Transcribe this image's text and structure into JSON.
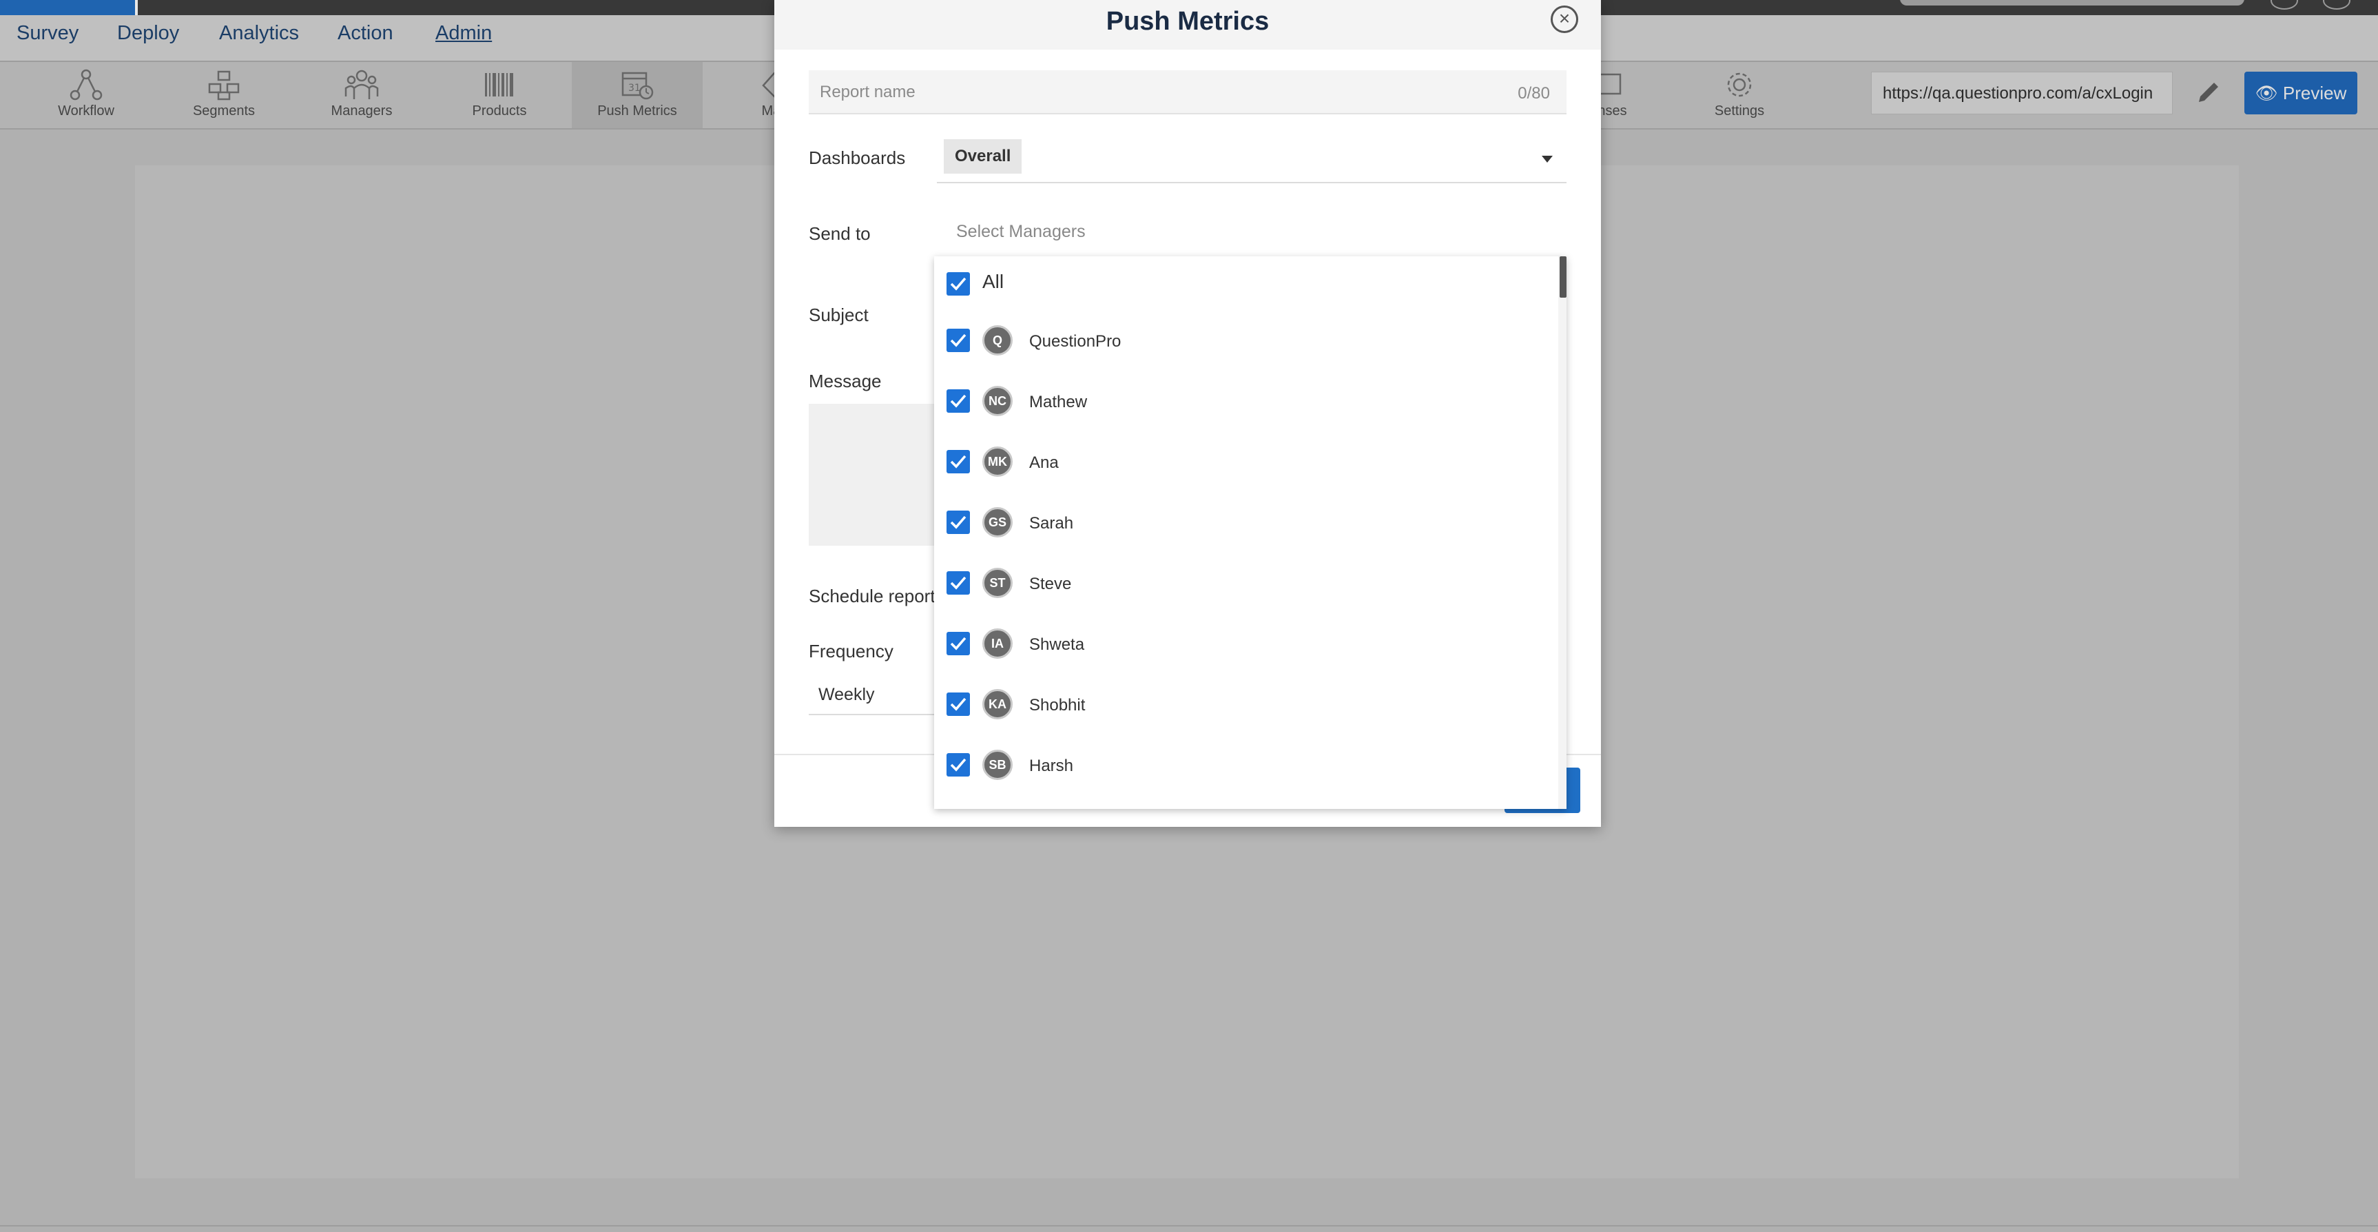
{
  "nav": {
    "items": [
      "Survey",
      "Deploy",
      "Analytics",
      "Action",
      "Admin"
    ],
    "active": "Admin"
  },
  "toolbar": {
    "tools": [
      {
        "label": "Workflow",
        "icon": "workflow-icon"
      },
      {
        "label": "Segments",
        "icon": "segments-icon"
      },
      {
        "label": "Managers",
        "icon": "managers-icon"
      },
      {
        "label": "Products",
        "icon": "barcode-icon"
      },
      {
        "label": "Push Metrics",
        "icon": "calendar-clock-icon"
      },
      {
        "label": "Map",
        "icon": "map-tag-icon"
      },
      {
        "label": "onses",
        "icon": "responses-icon"
      },
      {
        "label": "Settings",
        "icon": "gear-icon"
      }
    ],
    "active_tool": "Push Metrics",
    "url": "https://qa.questionpro.com/a/cxLogin",
    "preview_label": "Preview"
  },
  "modal": {
    "title": "Push Metrics",
    "report_name_placeholder": "Report name",
    "report_name_counter": "0/80",
    "dashboards_label": "Dashboards",
    "dashboards_value": "Overall",
    "send_to_label": "Send to",
    "send_to_placeholder": "Select Managers",
    "subject_label": "Subject",
    "message_label": "Message",
    "schedule_label": "Schedule report",
    "frequency_label": "Frequency",
    "frequency_value": "Weekly"
  },
  "dropdown": {
    "all_label": "All",
    "all_checked": true,
    "managers": [
      {
        "initials": "Q",
        "name": "QuestionPro",
        "checked": true
      },
      {
        "initials": "NC",
        "name": "Mathew",
        "checked": true
      },
      {
        "initials": "MK",
        "name": "Ana",
        "checked": true
      },
      {
        "initials": "GS",
        "name": "Sarah",
        "checked": true
      },
      {
        "initials": "ST",
        "name": "Steve",
        "checked": true
      },
      {
        "initials": "IA",
        "name": "Shweta",
        "checked": true
      },
      {
        "initials": "KA",
        "name": "Shobhit",
        "checked": true
      },
      {
        "initials": "SB",
        "name": "Harsh",
        "checked": true
      }
    ]
  },
  "colors": {
    "accent": "#1e73d8",
    "nav_text": "#1b3d66",
    "avatar": "#6a6a6a"
  }
}
